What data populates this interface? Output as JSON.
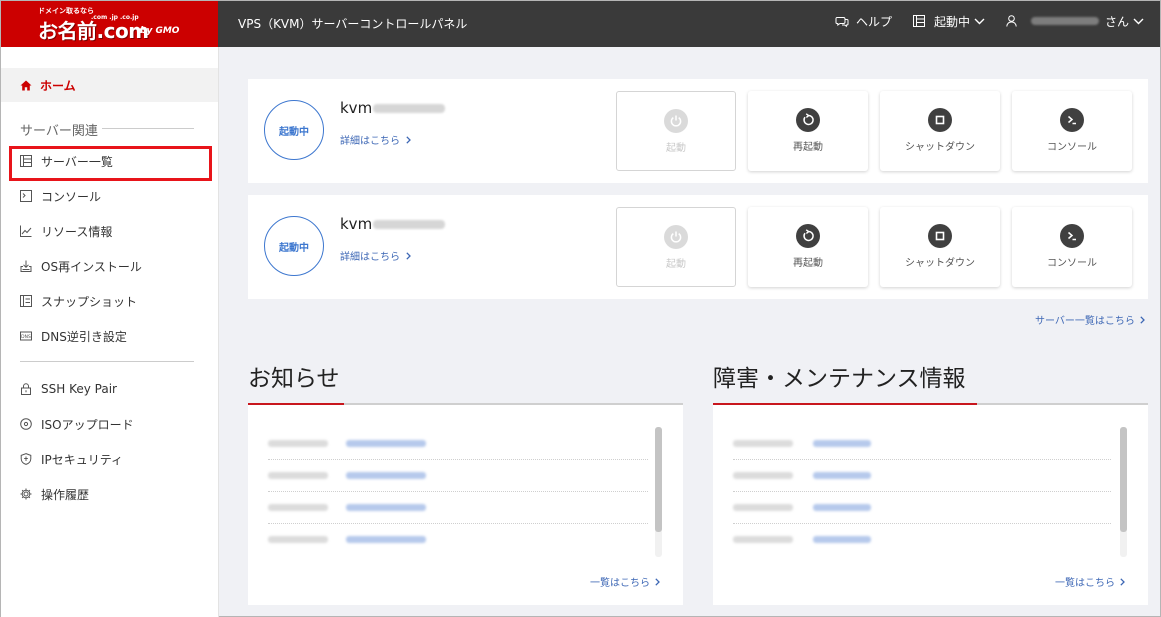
{
  "header": {
    "logo_tagline": "ドメイン取るなら",
    "logo_tlds": ".com .jp .co.jp",
    "logo_main": "お名前.com",
    "logo_gmo": "by GMO",
    "app_title": "VPS（KVM）サーバーコントロールパネル",
    "help_label": "ヘルプ",
    "status_label": "起動中",
    "user_suffix": "さん"
  },
  "sidebar": {
    "home_label": "ホーム",
    "section_title": "サーバー関連",
    "items": [
      {
        "label": "サーバー一覧",
        "icon": "server-list-icon"
      },
      {
        "label": "コンソール",
        "icon": "console-icon"
      },
      {
        "label": "リソース情報",
        "icon": "chart-icon"
      },
      {
        "label": "OS再インストール",
        "icon": "reinstall-icon"
      },
      {
        "label": "スナップショット",
        "icon": "snapshot-icon"
      },
      {
        "label": "DNS逆引き設定",
        "icon": "dns-icon"
      }
    ],
    "items2": [
      {
        "label": "SSH Key Pair",
        "icon": "lock-icon"
      },
      {
        "label": "ISOアップロード",
        "icon": "disc-icon"
      },
      {
        "label": "IPセキュリティ",
        "icon": "shield-icon"
      },
      {
        "label": "操作履歴",
        "icon": "gear-icon"
      }
    ]
  },
  "servers": [
    {
      "status": "起動中",
      "name_prefix": "kvm",
      "detail_link": "詳細はこちら"
    },
    {
      "status": "起動中",
      "name_prefix": "kvm",
      "detail_link": "詳細はこちら"
    }
  ],
  "actions": {
    "start": "起動",
    "restart": "再起動",
    "shutdown": "シャットダウン",
    "console": "コンソール"
  },
  "server_list_link": "サーバー一覧はこちら",
  "news": {
    "title": "お知らせ",
    "more_link": "一覧はこちら"
  },
  "maintenance": {
    "title": "障害・メンテナンス情報",
    "more_link": "一覧はこちら"
  },
  "colors": {
    "brand_red": "#cc0000",
    "accent_blue": "#3d77cf",
    "topbar": "#3a3a3a",
    "highlight": "#e8141a"
  }
}
